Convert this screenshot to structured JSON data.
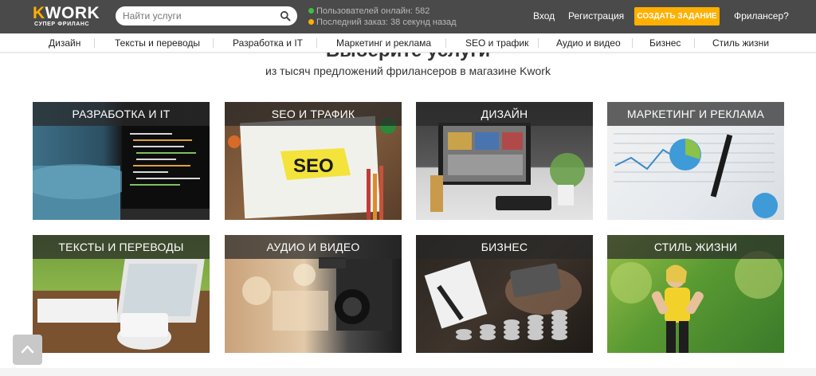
{
  "header": {
    "logo_text": "KWORK",
    "logo_sub": "СУПЕР ФРИЛАНС",
    "search_placeholder": "Найти услуги",
    "online_label": "Пользователей онлайн: 582",
    "last_order_label": "Последний заказ: 38 секунд назад",
    "online_dot_color": "#3ec03e",
    "last_order_dot_color": "#ffb000",
    "login": "Вход",
    "register": "Регистрация",
    "create_task": "СОЗДАТЬ ЗАДАНИЕ",
    "freelancer": "Фрилансер?"
  },
  "categories": [
    "Дизайн",
    "Тексты и переводы",
    "Разработка и IT",
    "Маркетинг и реклама",
    "SEO и трафик",
    "Аудио и видео",
    "Бизнес",
    "Стиль жизни"
  ],
  "main": {
    "title": "Выберите услуги",
    "subtitle": "из тысяч предложений фрилансеров в магазине Kwork"
  },
  "tiles": [
    "РАЗРАБОТКА И IT",
    "SEO И ТРАФИК",
    "ДИЗАЙН",
    "МАРКЕТИНГ И РЕКЛАМА",
    "ТЕКСТЫ И ПЕРЕВОДЫ",
    "АУДИО И ВИДЕО",
    "БИЗНЕС",
    "СТИЛЬ ЖИЗНИ"
  ],
  "colors": {
    "header_bg": "#4a4a4a",
    "accent": "#ffb000"
  }
}
